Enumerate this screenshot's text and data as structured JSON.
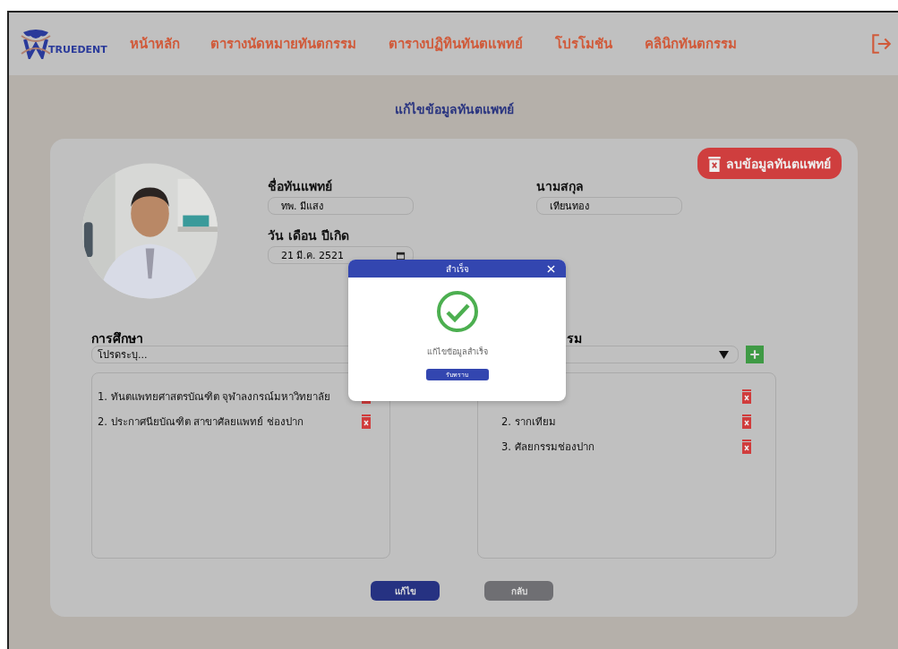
{
  "nav": {
    "logo": "TRUEDENT",
    "items": [
      {
        "label": "หน้าหลัก",
        "selected": false
      },
      {
        "label": "ตารางนัดหมายทันตกรรม",
        "selected": false
      },
      {
        "label": "ตารางปฏิทินทันตแพทย์",
        "selected": false
      },
      {
        "label": "โปรโมชัน",
        "selected": false
      },
      {
        "label": "คลินิกทันตกรรม",
        "selected": false
      }
    ]
  },
  "page_title": "แก้ไขข้อมูลทันตแพทย์",
  "delete_button": "ลบข้อมูลทันตแพทย์",
  "photo": {
    "kind": "picture"
  },
  "fields": [
    {
      "label": "ชื่อทันแพทย์",
      "value": "ทพ. มีแสง"
    },
    {
      "label": "นามสกุล",
      "value": "เทียนทอง"
    },
    {
      "label": "วัน เดือน ปีเกิด",
      "value": "21 มี.ค. 2521"
    }
  ],
  "education": {
    "heading": "การศึกษา",
    "placeholder": "โปรดระบุ...",
    "items": [
      "1. ทันตแพทยศาสตรบัณฑิต จุฬาลงกรณ์มหาวิทยาลัย",
      "2. ประกาศนียบัณฑิต สาขาศัลยแพทย์ ช่องปาก"
    ]
  },
  "treatments": {
    "heading": "รม",
    "items": [
      {
        "kind": "covered"
      },
      {
        "kind": "text",
        "text": "2. รากเทียม"
      },
      {
        "kind": "text",
        "text": "3. ศัลยกรรมช่องปาก"
      }
    ]
  },
  "buttons": [
    "แก้ไข",
    "กลับ"
  ],
  "dialog": {
    "title": "สำเร็จ",
    "message": "แก้ไขข้อมูลสำเร็จ",
    "button": "รับทราบ"
  }
}
